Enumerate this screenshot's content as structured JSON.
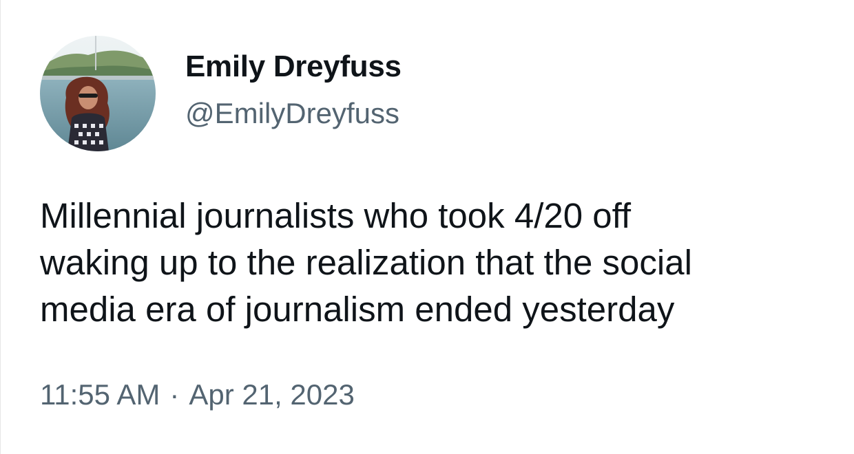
{
  "tweet": {
    "author": {
      "display_name": "Emily Dreyfuss",
      "handle": "@EmilyDreyfuss",
      "avatar": "profile-photo"
    },
    "text_lines": [
      "Millennial journalists who took 4/20 off",
      "waking up to the realization that the social",
      "media era of journalism ended yesterday"
    ],
    "time": "11:55 AM",
    "separator": "·",
    "date": "Apr 21, 2023"
  },
  "colors": {
    "primary_text": "#0f1419",
    "secondary_text": "#536471",
    "background": "#ffffff"
  }
}
